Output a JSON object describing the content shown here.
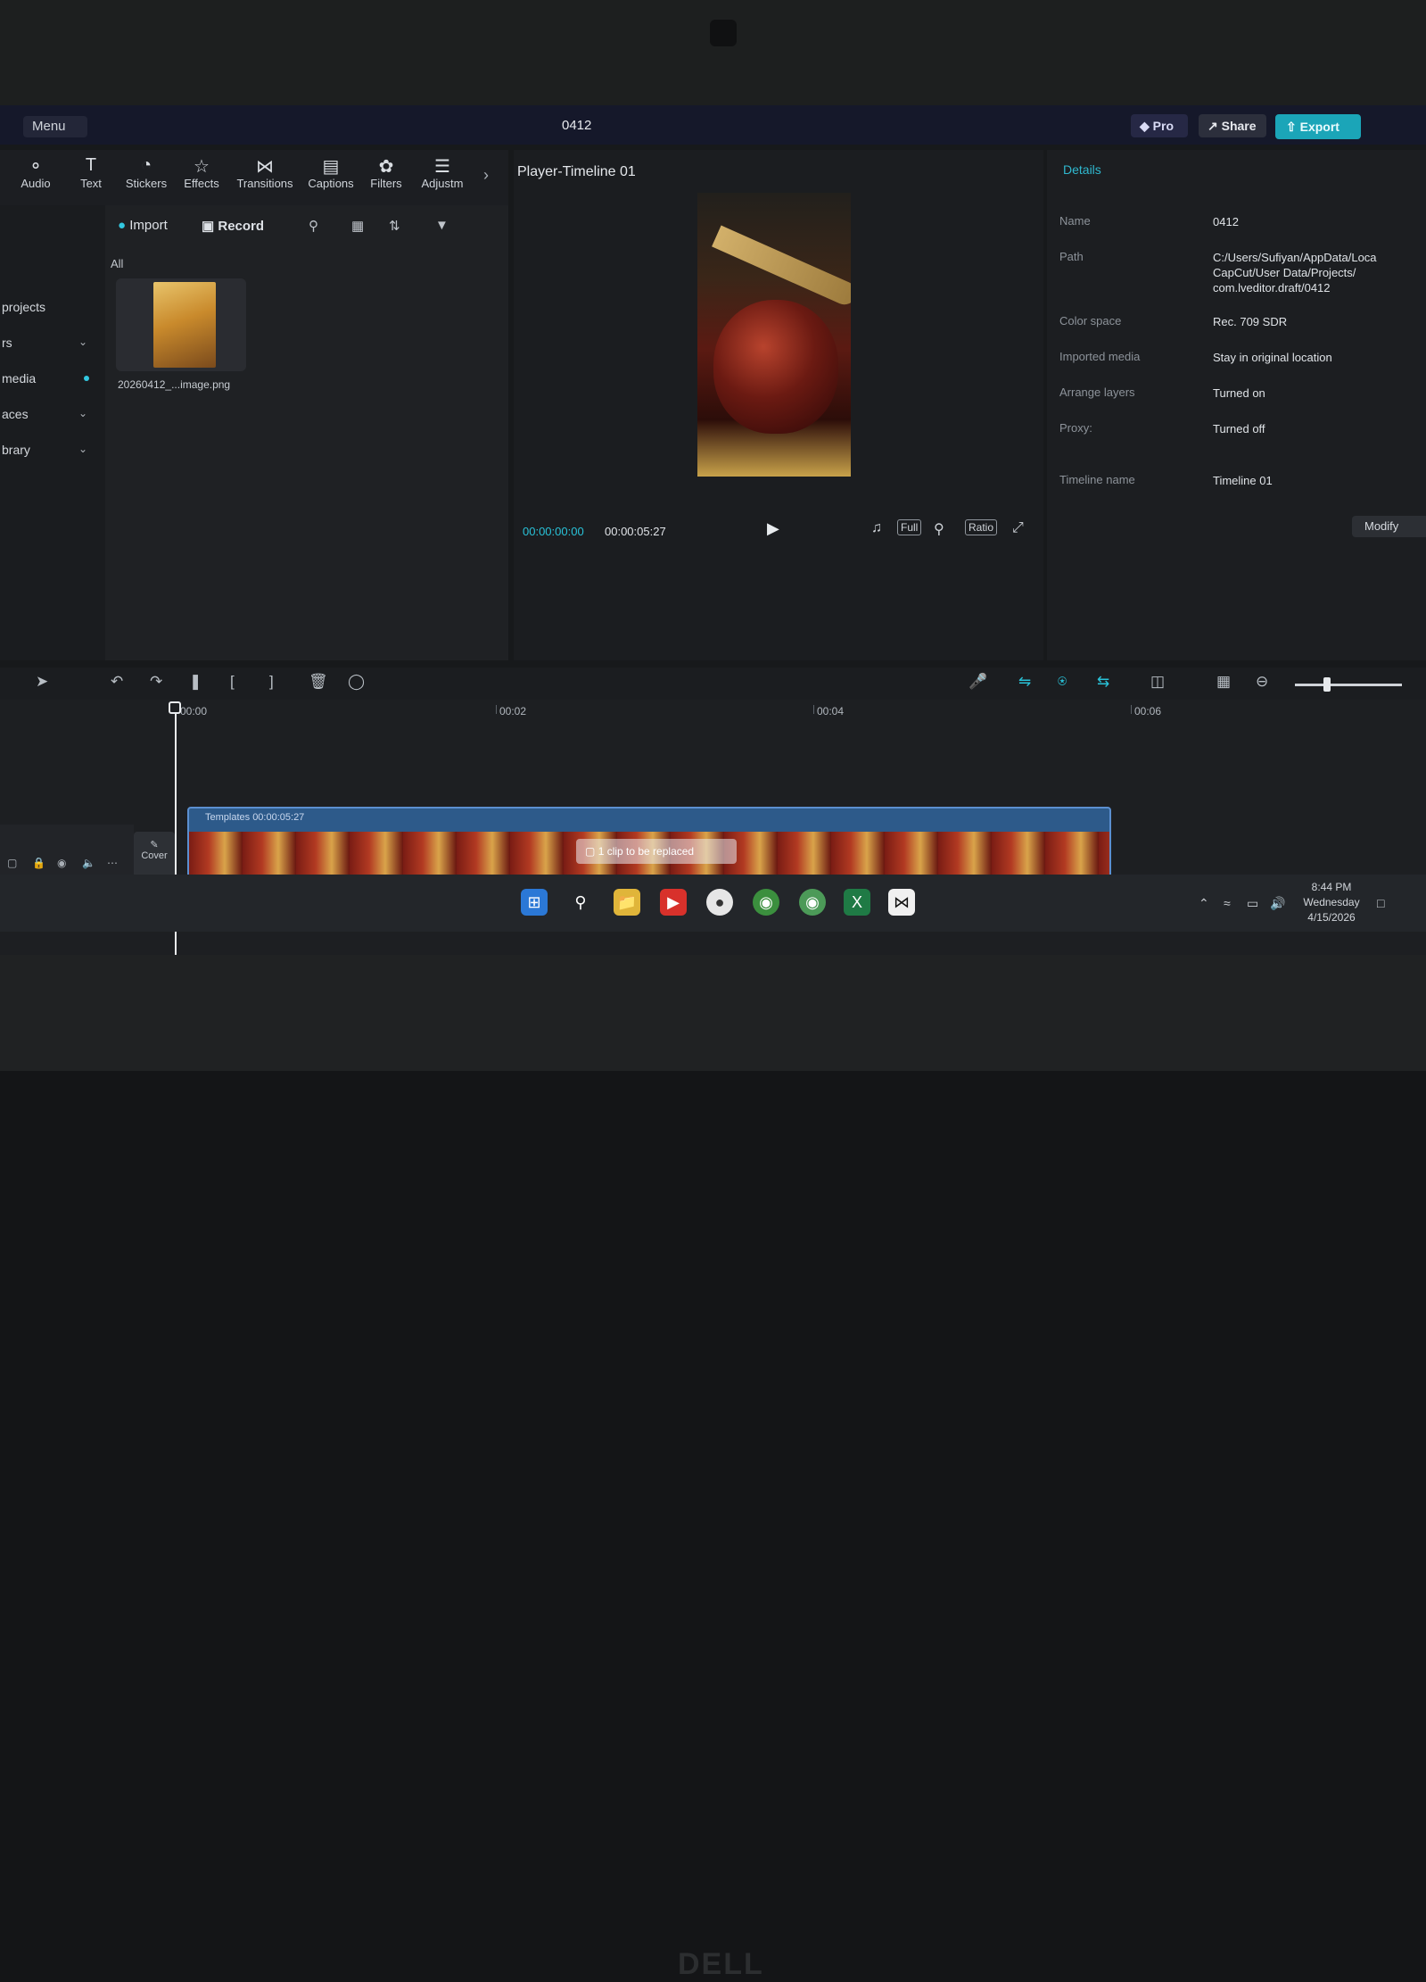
{
  "app": {
    "menu_label": "Menu",
    "project_title": "0412",
    "pro_label": "Pro",
    "share_label": "Share",
    "export_label": "Export"
  },
  "toolbar": {
    "tools": [
      "Audio",
      "Text",
      "Stickers",
      "Effects",
      "Transitions",
      "Captions",
      "Filters",
      "Adjustm"
    ]
  },
  "leftnav": {
    "items": [
      "projects",
      "rs",
      "media",
      "aces",
      "brary"
    ]
  },
  "media": {
    "import_label": "Import",
    "record_label": "Record",
    "filter_label": "All",
    "file_name": "20260412_...image.png"
  },
  "player": {
    "title": "Player-Timeline 01",
    "current_time": "00:00:00:00",
    "duration": "00:00:05:27",
    "full_label": "Full",
    "ratio_label": "Ratio"
  },
  "details": {
    "title": "Details",
    "rows": [
      {
        "label": "Name",
        "value": "0412"
      },
      {
        "label": "Path",
        "value": "C:/Users/Sufiyan/AppData/Loca CapCut/User Data/Projects/ com.lveditor.draft/0412"
      },
      {
        "label": "Color space",
        "value": "Rec. 709 SDR"
      },
      {
        "label": "Imported media",
        "value": "Stay in original location"
      },
      {
        "label": "Arrange layers",
        "value": "Turned on"
      },
      {
        "label": "Proxy:",
        "value": "Turned off"
      },
      {
        "label": "Timeline name",
        "value": "Timeline 01"
      }
    ],
    "modify_label": "Modify"
  },
  "timeline": {
    "ruler": [
      "00:00",
      "00:02",
      "00:04",
      "00:06"
    ],
    "cover_label": "Cover",
    "clip_label": "Templates  00:00:05:27",
    "clip_badge": "1 clip to be replaced"
  },
  "taskbar": {
    "time": "8:44 PM",
    "day": "Wednesday",
    "date": "4/15/2026"
  },
  "brand": "DELL",
  "colors": {
    "accent": "#29c2d8",
    "export": "#1ba5b8",
    "clip": "#2d5a8a"
  }
}
